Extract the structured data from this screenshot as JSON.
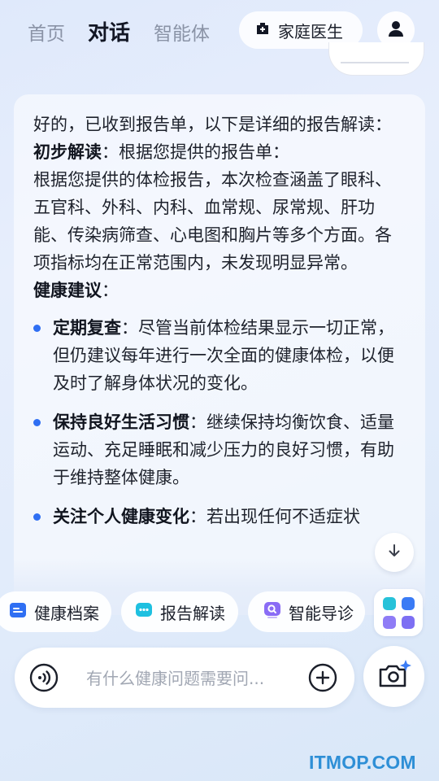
{
  "nav": {
    "tabs": [
      {
        "label": "首页"
      },
      {
        "label": "对话"
      },
      {
        "label": "智能体"
      }
    ],
    "active_tab": "对话",
    "doctor_button": "家庭医生"
  },
  "message": {
    "intro": "好的，已收到报告单，以下是详细的报告解读：",
    "prelim_title": "初步解读",
    "prelim_text": "：根据您提供的报告单：",
    "body": "根据您提供的体检报告，本次检查涵盖了眼科、五官科、外科、内科、血常规、尿常规、肝功能、传染病筛查、心电图和胸片等多个方面。各项指标均在正常范围内，未发现明显异常。",
    "advice_title": "健康建议",
    "advice_colon": "：",
    "items": [
      {
        "title": "定期复查",
        "text": "：尽管当前体检结果显示一切正常，但仍建议每年进行一次全面的健康体检，以便及时了解身体状况的变化。"
      },
      {
        "title": "保持良好生活习惯",
        "text": "：继续保持均衡饮食、适量运动、充足睡眠和减少压力的良好习惯，有助于维持整体健康。"
      },
      {
        "title": "关注个人健康变化",
        "text": "：若出现任何不适症状"
      }
    ]
  },
  "quick_actions": [
    {
      "label": "健康档案",
      "icon": "folder-icon",
      "color": "#2f6ff3"
    },
    {
      "label": "报告解读",
      "icon": "report-chat-icon",
      "color": "#1ec0e0"
    },
    {
      "label": "智能导诊",
      "icon": "search-guide-icon",
      "color": "#8a6cf5"
    }
  ],
  "input": {
    "placeholder": "有什么健康问题需要问..."
  },
  "watermark": "ITMOP.COM",
  "colors": {
    "accent": "#2f6ff3",
    "watermark": "#2e8fd6"
  }
}
